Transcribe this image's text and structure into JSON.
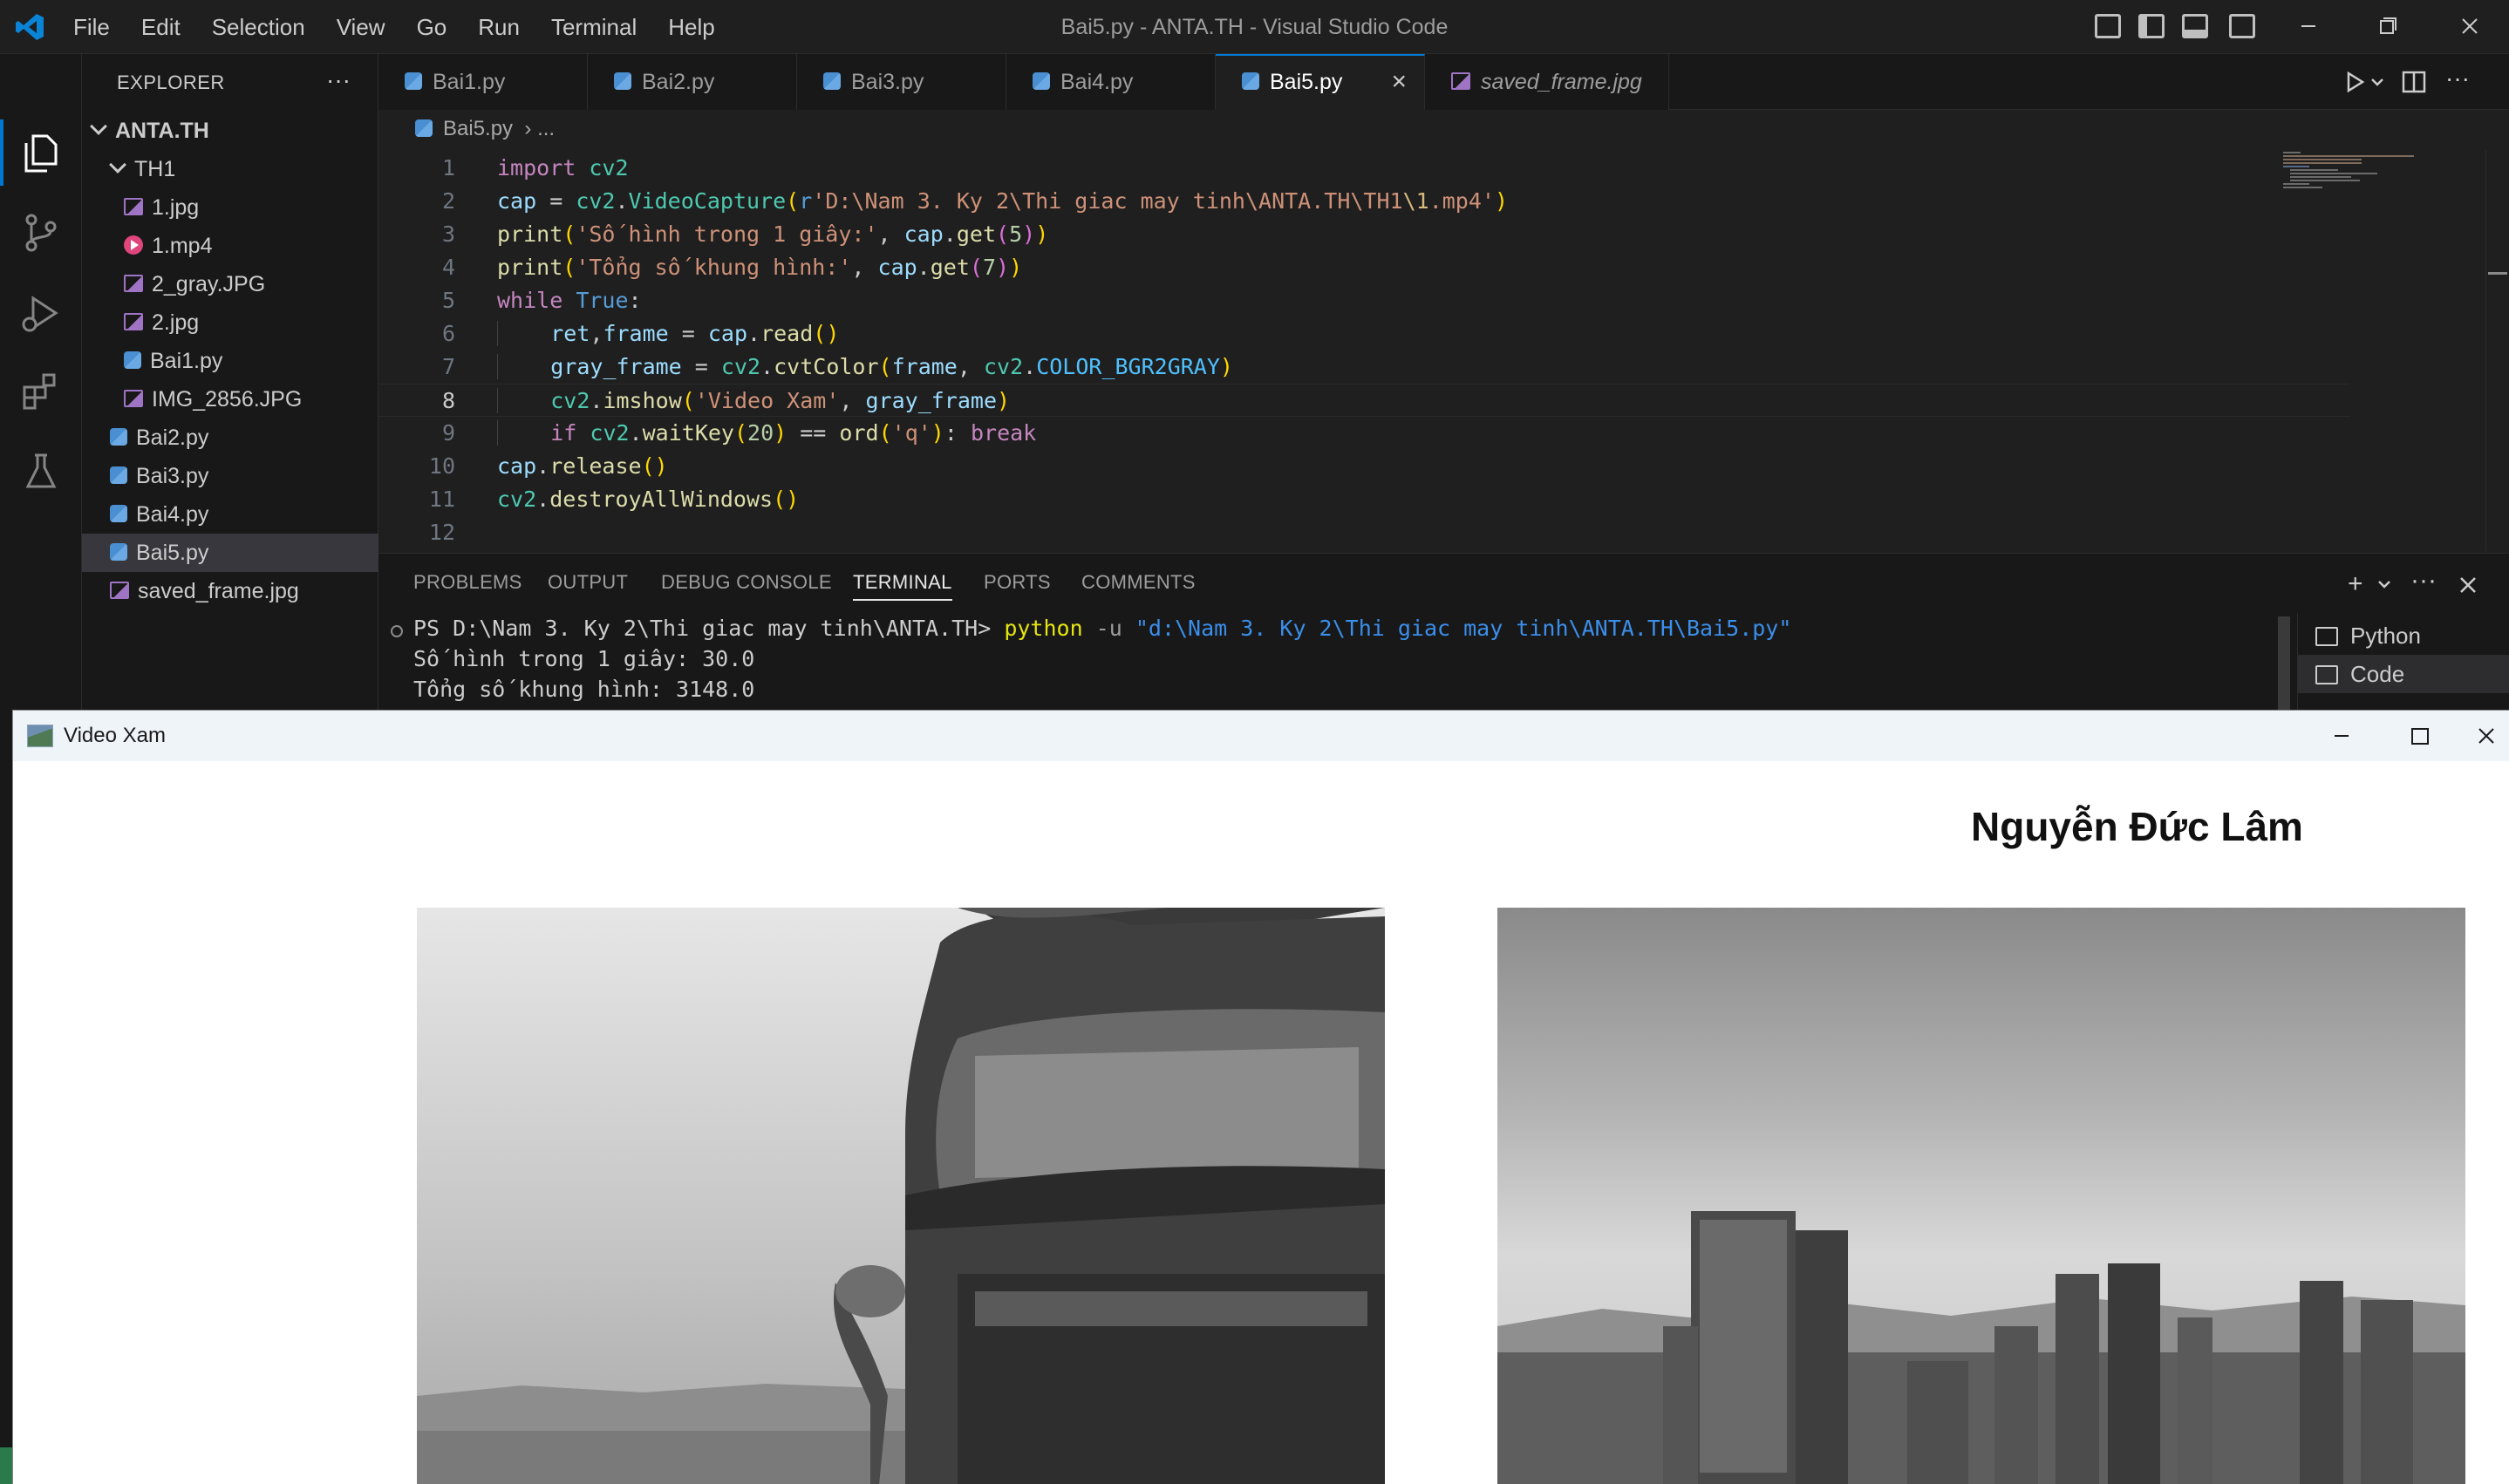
{
  "titlebar": {
    "menu": [
      "File",
      "Edit",
      "Selection",
      "View",
      "Go",
      "Run",
      "Terminal",
      "Help"
    ],
    "window_title": "Bai5.py - ANTA.TH - Visual Studio Code"
  },
  "sidebar": {
    "title": "EXPLORER",
    "more": "···",
    "root": "ANTA.TH",
    "folder": "TH1",
    "folder_items": [
      {
        "label": "1.jpg",
        "icon": "image-file-icon"
      },
      {
        "label": "1.mp4",
        "icon": "video-file-icon"
      },
      {
        "label": "2_gray.JPG",
        "icon": "image-file-icon"
      },
      {
        "label": "2.jpg",
        "icon": "image-file-icon"
      },
      {
        "label": "Bai1.py",
        "icon": "python-file-icon"
      },
      {
        "label": "IMG_2856.JPG",
        "icon": "image-file-icon"
      }
    ],
    "root_items": [
      {
        "label": "Bai2.py",
        "icon": "python-file-icon"
      },
      {
        "label": "Bai3.py",
        "icon": "python-file-icon"
      },
      {
        "label": "Bai4.py",
        "icon": "python-file-icon"
      },
      {
        "label": "Bai5.py",
        "icon": "python-file-icon",
        "selected": true
      },
      {
        "label": "saved_frame.jpg",
        "icon": "image-file-icon"
      }
    ]
  },
  "tabs": [
    {
      "label": "Bai1.py"
    },
    {
      "label": "Bai2.py"
    },
    {
      "label": "Bai3.py"
    },
    {
      "label": "Bai4.py"
    },
    {
      "label": "Bai5.py",
      "active": true
    },
    {
      "label": "saved_frame.jpg",
      "italic": true
    }
  ],
  "breadcrumb": {
    "file": "Bai5.py",
    "rest": "..."
  },
  "editor": {
    "line_numbers": [
      "1",
      "2",
      "3",
      "4",
      "5",
      "6",
      "7",
      "8",
      "9",
      "10",
      "11",
      "12"
    ],
    "current_line": "8"
  },
  "panel": {
    "tabs": [
      "PROBLEMS",
      "OUTPUT",
      "DEBUG CONSOLE",
      "TERMINAL",
      "PORTS",
      "COMMENTS"
    ],
    "active_tab": "TERMINAL",
    "terminal": {
      "prompt": "PS D:\\Nam 3. Ky 2\\Thi giac may tinh\\ANTA.TH> ",
      "cmd": "python",
      "flag": " -u ",
      "arg": "\"d:\\Nam 3. Ky 2\\Thi giac may tinh\\ANTA.TH\\Bai5.py\"",
      "output1": "Số hình trong 1 giây: 30.0",
      "output2": "Tổng số khung hình: 3148.0"
    },
    "terminal_list": [
      "Python",
      "Code"
    ]
  },
  "cv_window": {
    "title": "Video Xam",
    "overlay_text": "Nguyễn Đức Lâm"
  },
  "colors": {
    "accent": "#0078d4",
    "keyword": "#569cd6",
    "string": "#ce9178",
    "function": "#dcdcaa"
  }
}
